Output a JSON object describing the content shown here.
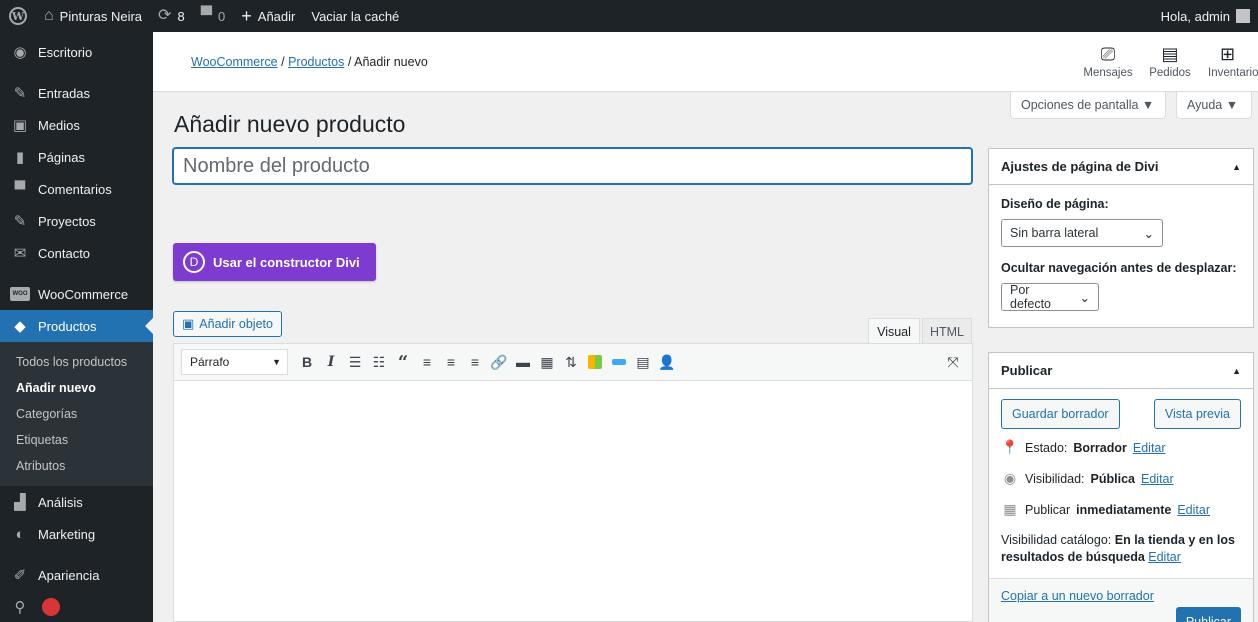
{
  "adminbar": {
    "site_name": "Pinturas Neira",
    "updates_count": "8",
    "comments_count": "0",
    "new_label": "Añadir",
    "cache_label": "Vaciar la caché",
    "greeting": "Hola, admin"
  },
  "sidebar": {
    "items_top": [
      {
        "label": "Escritorio",
        "icon": "dashboard-icon"
      },
      {
        "label": "Entradas",
        "icon": "pin-icon"
      },
      {
        "label": "Medios",
        "icon": "media-icon"
      },
      {
        "label": "Páginas",
        "icon": "page-icon"
      },
      {
        "label": "Comentarios",
        "icon": "comment-icon"
      },
      {
        "label": "Proyectos",
        "icon": "pin-icon"
      },
      {
        "label": "Contacto",
        "icon": "email-icon"
      }
    ],
    "woocommerce": "WooCommerce",
    "woo_badge": "WOO",
    "productos": "Productos",
    "submenu": [
      "Todos los productos",
      "Añadir nuevo",
      "Categorías",
      "Etiquetas",
      "Atributos"
    ],
    "analisis": "Análisis",
    "marketing": "Marketing",
    "apariencia": "Apariencia"
  },
  "header": {
    "crumb1": "WooCommerce",
    "crumb2": "Productos",
    "crumb3": "Añadir nuevo",
    "sep": "/",
    "actions": [
      "Mensajes",
      "Pedidos",
      "Inventario"
    ]
  },
  "screen_options": "Opciones de pantalla ▼",
  "help": "Ayuda ▼",
  "main": {
    "title": "Añadir nuevo producto",
    "name_placeholder": "Nombre del producto",
    "divi_button": "Usar el constructor Divi",
    "divi_logo": "D",
    "add_media": "Añadir objeto",
    "tab_visual": "Visual",
    "tab_html": "HTML",
    "format": "Párrafo"
  },
  "divi_box": {
    "title": "Ajustes de página de Divi",
    "layout_label": "Diseño de página:",
    "layout_value": "Sin barra lateral",
    "hide_nav_label": "Ocultar navegación antes de desplazar:",
    "hide_nav_value": "Por defecto"
  },
  "publish_box": {
    "title": "Publicar",
    "save_draft": "Guardar borrador",
    "preview": "Vista previa",
    "status_label": "Estado:",
    "status_value": "Borrador",
    "visibility_label": "Visibilidad:",
    "visibility_value": "Pública",
    "publish_label": "Publicar",
    "publish_value": "inmediatamente",
    "edit": "Editar",
    "catalog_label": "Visibilidad catálogo:",
    "catalog_value": "En la tienda y en los resultados de búsqueda",
    "copy_draft": "Copiar a un nuevo borrador",
    "publish_button": "Publicar"
  }
}
